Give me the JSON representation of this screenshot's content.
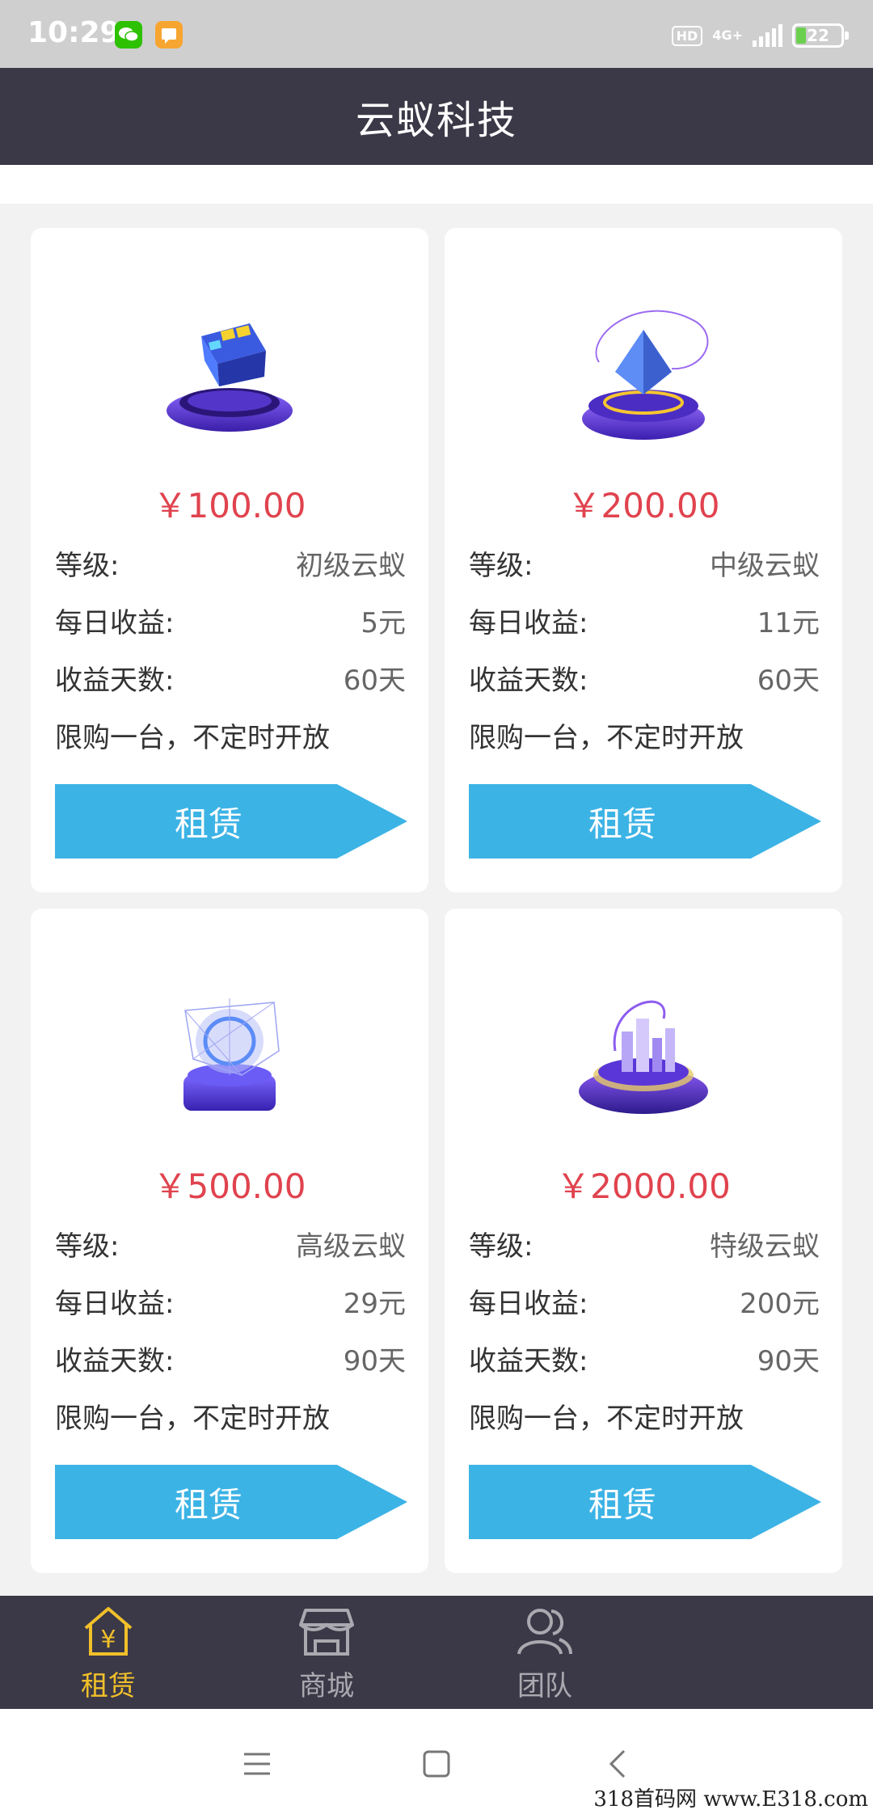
{
  "status": {
    "time": "10:29",
    "hd": "HD",
    "network": "4G+",
    "battery": "22"
  },
  "header": {
    "title": "云蚁科技"
  },
  "labels": {
    "level": "等级:",
    "daily": "每日收益:",
    "days": "收益天数:",
    "note": "限购一台，不定时开放",
    "rent": "租赁"
  },
  "products": [
    {
      "price": "￥100.00",
      "level": "初级云蚁",
      "daily": "5元",
      "days": "60天",
      "icon": "cube-platform-icon"
    },
    {
      "price": "￥200.00",
      "level": "中级云蚁",
      "daily": "11元",
      "days": "60天",
      "icon": "crystal-platform-icon"
    },
    {
      "price": "￥500.00",
      "level": "高级云蚁",
      "daily": "29元",
      "days": "90天",
      "icon": "hologram-platform-icon"
    },
    {
      "price": "￥2000.00",
      "level": "特级云蚁",
      "daily": "200元",
      "days": "90天",
      "icon": "city-platform-icon"
    }
  ],
  "tabs": [
    {
      "label": "租赁",
      "icon": "house-yen-icon",
      "active": true
    },
    {
      "label": "商城",
      "icon": "store-icon",
      "active": false
    },
    {
      "label": "团队",
      "icon": "team-icon",
      "active": false
    }
  ],
  "system_nav": [
    "menu-icon",
    "home-square-icon",
    "back-icon"
  ],
  "watermark": "318首码网 www.E318.com",
  "colors": {
    "header": "#3b3947",
    "price": "#e0434e",
    "button": "#3cb3e5",
    "active_tab": "#f1c02a"
  }
}
